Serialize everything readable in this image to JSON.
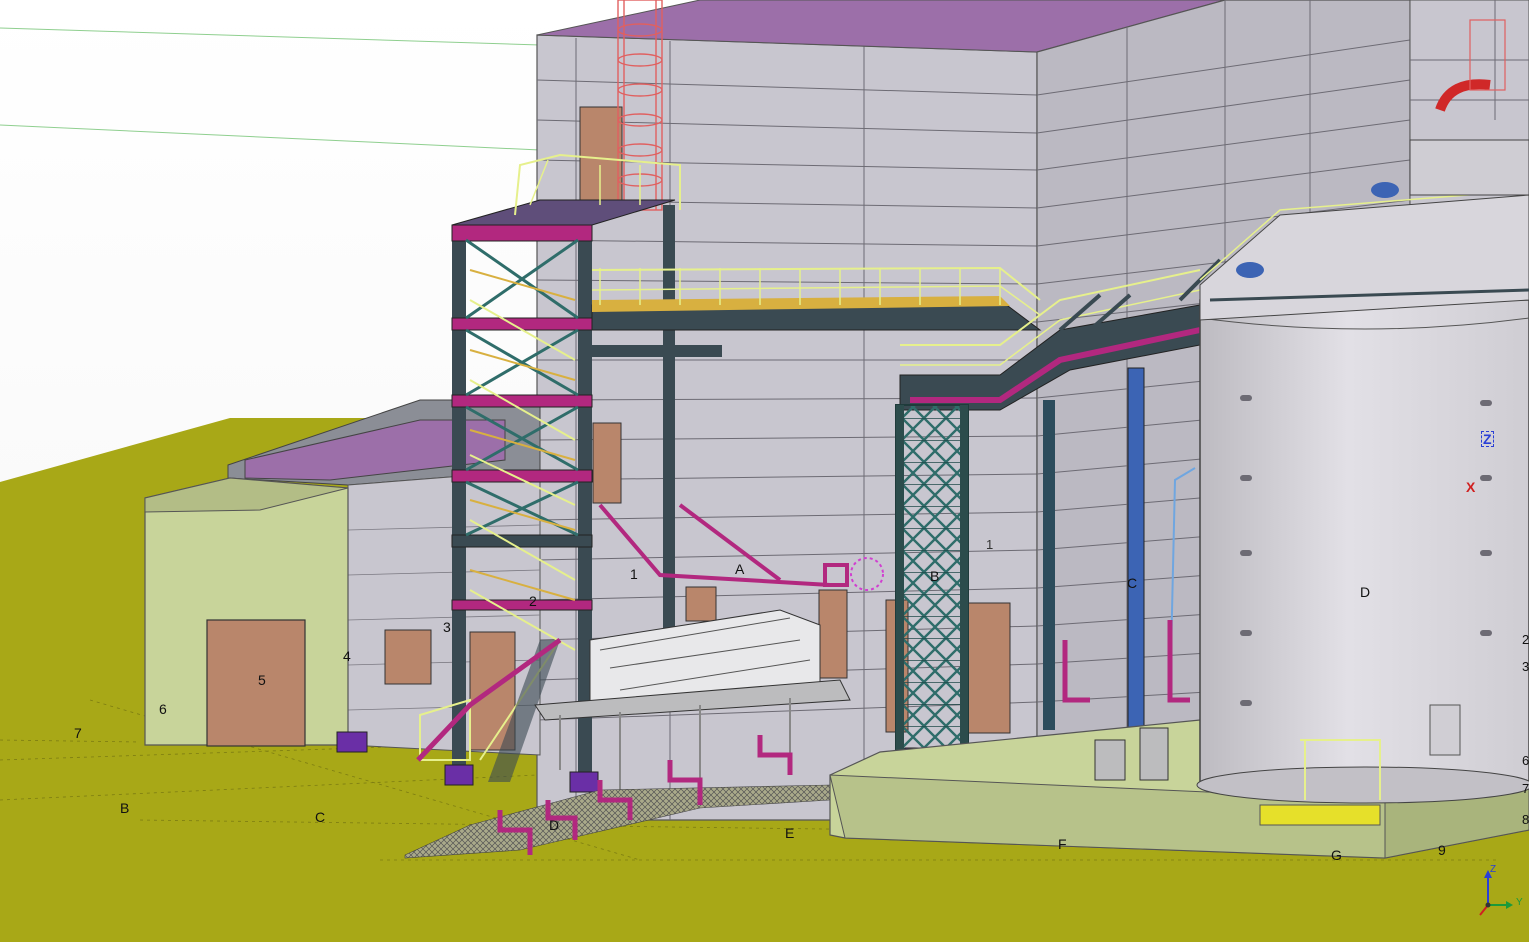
{
  "viewport": {
    "background_top": "#ffffff",
    "ground_color": "#a8a817",
    "building_color": "#c9c7cf",
    "roof_color": "#9b6fa8",
    "steel_color": "#3a4a52",
    "beam_magenta": "#b2287f",
    "handrail_color": "#e6f08c",
    "door_color": "#b8866b",
    "plinth_color": "#c8d49a",
    "tank_color": "#d6d4d8"
  },
  "grid_labels_numbers": [
    {
      "id": "n1",
      "text": "1"
    },
    {
      "id": "n2",
      "text": "2"
    },
    {
      "id": "n3",
      "text": "3"
    },
    {
      "id": "n4",
      "text": "4"
    },
    {
      "id": "n5",
      "text": "5"
    },
    {
      "id": "n6",
      "text": "6"
    },
    {
      "id": "n7",
      "text": "7"
    },
    {
      "id": "n9",
      "text": "9"
    }
  ],
  "grid_labels_letters": [
    {
      "id": "A",
      "text": "A"
    },
    {
      "id": "B_tower",
      "text": "B"
    },
    {
      "id": "C_column",
      "text": "C"
    },
    {
      "id": "D_tank",
      "text": "D"
    },
    {
      "id": "B_ground",
      "text": "B"
    },
    {
      "id": "C_ground",
      "text": "C"
    },
    {
      "id": "D_ground",
      "text": "D"
    },
    {
      "id": "E_ground",
      "text": "E"
    },
    {
      "id": "F_ground",
      "text": "F"
    },
    {
      "id": "G_ground",
      "text": "G"
    }
  ],
  "wall_marker": "1",
  "axis_markers": {
    "z": "Z",
    "x": "X"
  },
  "triad": {
    "z": "Z",
    "y": "Y"
  },
  "edge_labels": [
    "2",
    "3",
    "8",
    "7",
    "6"
  ]
}
